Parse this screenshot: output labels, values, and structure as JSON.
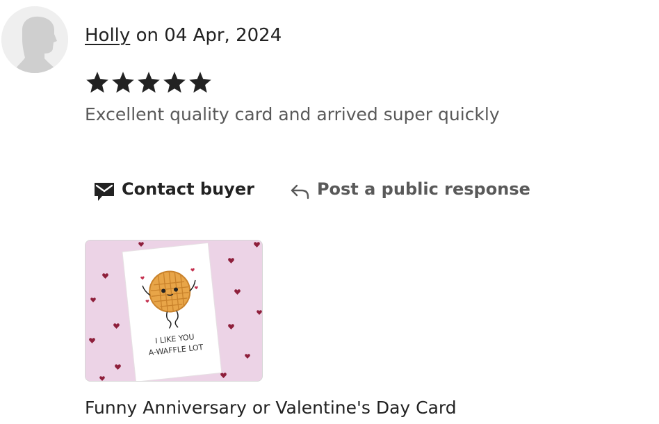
{
  "review": {
    "reviewer": "Holly",
    "date_prefix": "on",
    "date": "04 Apr, 2024",
    "rating": 5,
    "rating_max": 5,
    "text": "Excellent quality card and arrived super quickly"
  },
  "actions": {
    "contact_label": "Contact buyer",
    "contact_icon": "envelope-icon",
    "respond_label": "Post a public response",
    "respond_icon": "reply-arrow-icon"
  },
  "product": {
    "card_text_line1": "I LIKE YOU",
    "card_text_line2": "A-WAFFLE LOT",
    "title": "Funny Anniversary or Valentine's Day Card"
  },
  "colors": {
    "text_primary": "#222222",
    "text_secondary": "#595959",
    "star": "#222222",
    "thumb_background": "#ecd3e6",
    "heart": "#8e1f3b",
    "waffle": "#e8a548"
  }
}
